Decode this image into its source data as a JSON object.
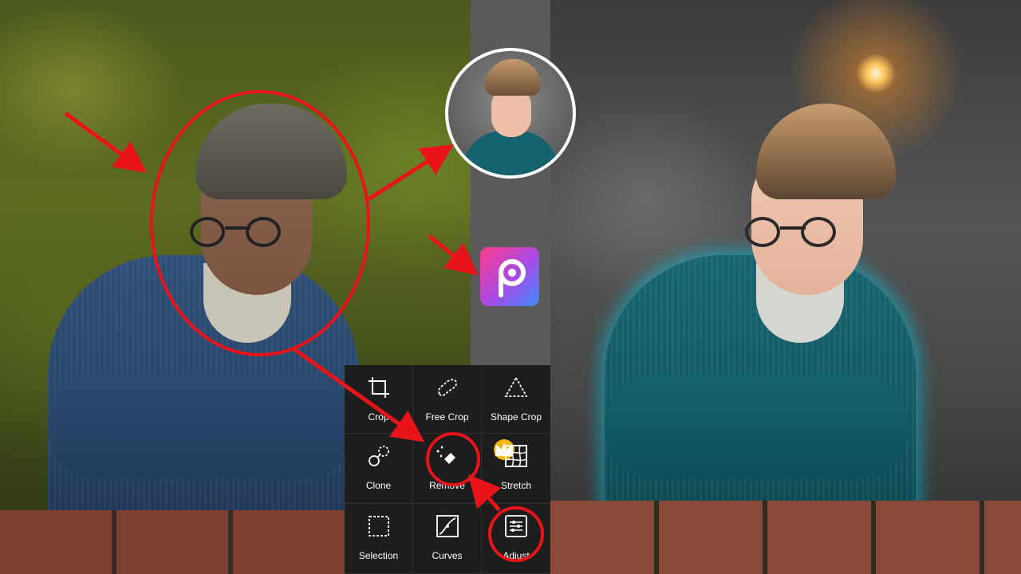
{
  "tools_menu": {
    "items": [
      {
        "label": "Crop",
        "icon": "crop-icon"
      },
      {
        "label": "Free Crop",
        "icon": "free-crop-icon"
      },
      {
        "label": "Shape Crop",
        "icon": "shape-crop-icon"
      },
      {
        "label": "Clone",
        "icon": "clone-icon"
      },
      {
        "label": "Remove",
        "icon": "remove-icon",
        "badge": "crown-icon"
      },
      {
        "label": "Stretch",
        "icon": "stretch-icon"
      },
      {
        "label": "Selection",
        "icon": "selection-icon"
      },
      {
        "label": "Curves",
        "icon": "curves-icon"
      },
      {
        "label": "Adjust",
        "icon": "adjust-icon"
      }
    ]
  },
  "app_icon": {
    "name": "picsart-icon",
    "colors": [
      "#ff3d8b",
      "#a64ae6",
      "#3d8cff"
    ]
  },
  "colors": {
    "annotation_red": "#e8141a",
    "menu_background": "#1d1d1d",
    "premium_badge": "#f5b400",
    "glow": "#00c8e6"
  }
}
